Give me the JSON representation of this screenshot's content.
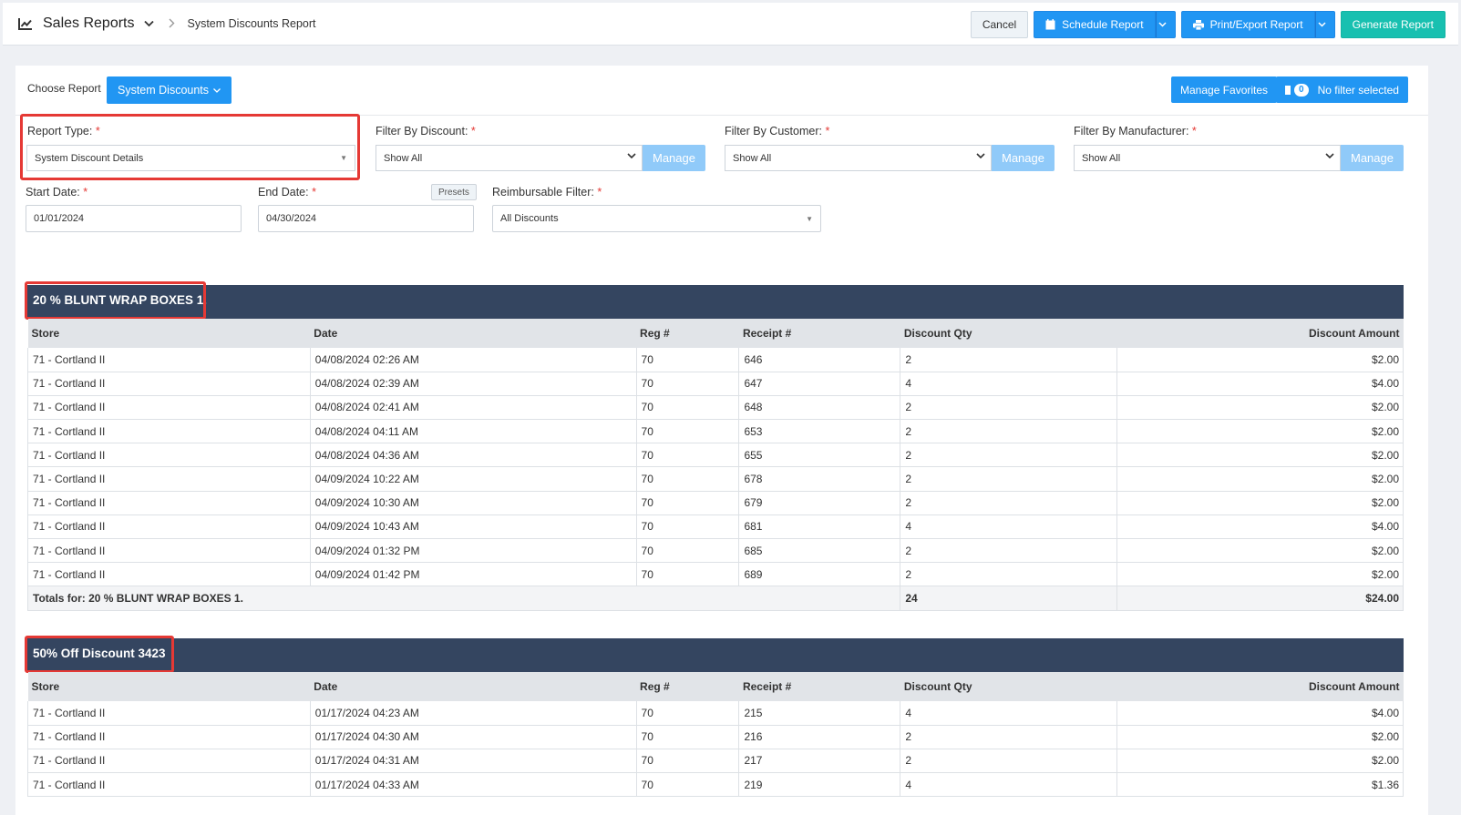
{
  "header": {
    "app_title": "Sales Reports",
    "breadcrumb": "System Discounts Report",
    "cancel_label": "Cancel",
    "schedule_label": "Schedule Report",
    "print_label": "Print/Export Report",
    "generate_label": "Generate Report"
  },
  "toolbar": {
    "choose_label": "Choose Report",
    "choose_value": "System Discounts",
    "manage_favorites": "Manage Favorites",
    "filter_count": "0",
    "filter_text": "No filter selected"
  },
  "filters": {
    "report_type": {
      "label": "Report Type:",
      "value": "System Discount Details"
    },
    "discount": {
      "label": "Filter By Discount:",
      "value": "Show All"
    },
    "customer": {
      "label": "Filter By Customer:",
      "value": "Show All"
    },
    "manufacturer": {
      "label": "Filter By Manufacturer:",
      "value": "Show All"
    },
    "manage_label": "Manage",
    "start_date": {
      "label": "Start Date:",
      "value": "01/01/2024"
    },
    "end_date": {
      "label": "End Date:",
      "value": "04/30/2024"
    },
    "presets_label": "Presets",
    "reimbursable": {
      "label": "Reimbursable Filter:",
      "value": "All Discounts"
    },
    "required_mark": "*"
  },
  "columns": [
    "Store",
    "Date",
    "Reg #",
    "Receipt #",
    "Discount Qty",
    "Discount Amount"
  ],
  "groups": [
    {
      "title": "20 % BLUNT WRAP BOXES 1.",
      "rows": [
        [
          "71 - Cortland II",
          "04/08/2024 02:26 AM",
          "70",
          "646",
          "2",
          "$2.00"
        ],
        [
          "71 - Cortland II",
          "04/08/2024 02:39 AM",
          "70",
          "647",
          "4",
          "$4.00"
        ],
        [
          "71 - Cortland II",
          "04/08/2024 02:41 AM",
          "70",
          "648",
          "2",
          "$2.00"
        ],
        [
          "71 - Cortland II",
          "04/08/2024 04:11 AM",
          "70",
          "653",
          "2",
          "$2.00"
        ],
        [
          "71 - Cortland II",
          "04/08/2024 04:36 AM",
          "70",
          "655",
          "2",
          "$2.00"
        ],
        [
          "71 - Cortland II",
          "04/09/2024 10:22 AM",
          "70",
          "678",
          "2",
          "$2.00"
        ],
        [
          "71 - Cortland II",
          "04/09/2024 10:30 AM",
          "70",
          "679",
          "2",
          "$2.00"
        ],
        [
          "71 - Cortland II",
          "04/09/2024 10:43 AM",
          "70",
          "681",
          "4",
          "$4.00"
        ],
        [
          "71 - Cortland II",
          "04/09/2024 01:32 PM",
          "70",
          "685",
          "2",
          "$2.00"
        ],
        [
          "71 - Cortland II",
          "04/09/2024 01:42 PM",
          "70",
          "689",
          "2",
          "$2.00"
        ]
      ],
      "totals": {
        "label": "Totals for: 20 % BLUNT WRAP BOXES 1.",
        "qty": "24",
        "amount": "$24.00"
      }
    },
    {
      "title": "50% Off Discount 3423",
      "rows": [
        [
          "71 - Cortland II",
          "01/17/2024 04:23 AM",
          "70",
          "215",
          "4",
          "$4.00"
        ],
        [
          "71 - Cortland II",
          "01/17/2024 04:30 AM",
          "70",
          "216",
          "2",
          "$2.00"
        ],
        [
          "71 - Cortland II",
          "01/17/2024 04:31 AM",
          "70",
          "217",
          "2",
          "$2.00"
        ],
        [
          "71 - Cortland II",
          "01/17/2024 04:33 AM",
          "70",
          "219",
          "4",
          "$1.36"
        ]
      ]
    }
  ],
  "colors": {
    "header_bar": "#344560",
    "primary": "#2196f3",
    "accent": "#18c0b0",
    "highlight": "#e53935"
  }
}
